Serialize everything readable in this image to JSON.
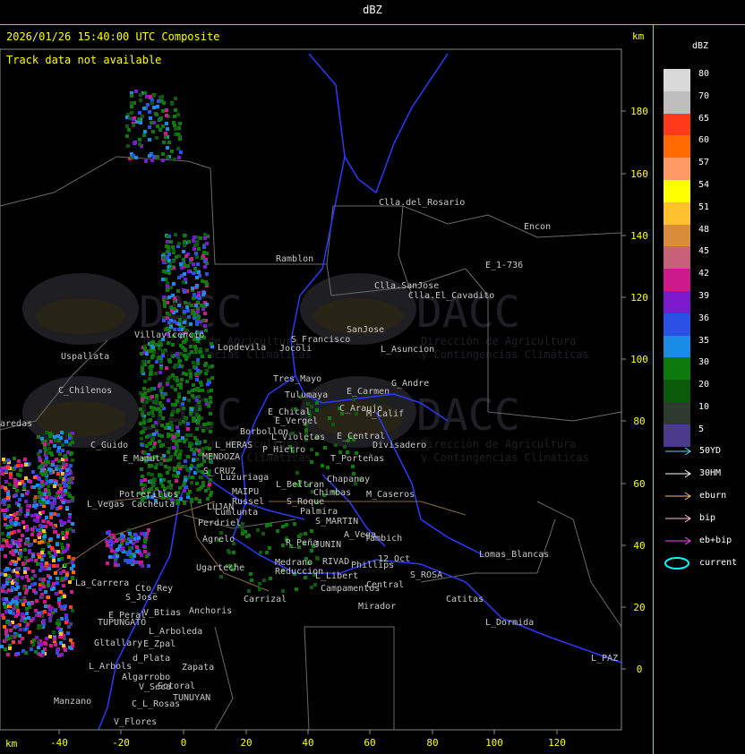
{
  "window": {
    "title": "dBZ"
  },
  "header": {
    "timestamp": "2026/01/26 15:40:00 UTC Composite",
    "track_status": "Track data not available",
    "km_label": "km"
  },
  "legend": {
    "title": "dBZ",
    "levels": [
      {
        "label": "80",
        "color": "#d9d9d9"
      },
      {
        "label": "70",
        "color": "#bdbdbd"
      },
      {
        "label": "65",
        "color": "#ff3a1a"
      },
      {
        "label": "60",
        "color": "#ff6a00"
      },
      {
        "label": "57",
        "color": "#ff9966"
      },
      {
        "label": "54",
        "color": "#ffff00"
      },
      {
        "label": "51",
        "color": "#ffc22e"
      },
      {
        "label": "48",
        "color": "#d98c3a"
      },
      {
        "label": "45",
        "color": "#c8607a"
      },
      {
        "label": "42",
        "color": "#cc1a8c"
      },
      {
        "label": "39",
        "color": "#7a1acc"
      },
      {
        "label": "36",
        "color": "#2a50e6"
      },
      {
        "label": "35",
        "color": "#1a8ce6"
      },
      {
        "label": "30",
        "color": "#0e7a0e"
      },
      {
        "label": "20",
        "color": "#0a5a0a"
      },
      {
        "label": "10",
        "color": "#2e3a2e"
      },
      {
        "label": "5",
        "color": "#4a3a8c"
      }
    ],
    "tracks": [
      {
        "label": "50YD",
        "color": "#6cf"
      },
      {
        "label": "30HM",
        "color": "#fff"
      },
      {
        "label": "eburn",
        "color": "#f0c080"
      },
      {
        "label": "bip",
        "color": "#ffc0d0"
      },
      {
        "label": "eb+bip",
        "color": "#ff40ff"
      },
      {
        "label": "current",
        "color": "#00ffff"
      }
    ]
  },
  "axes": {
    "x_ticks": [
      "-40",
      "-20",
      "0",
      "20",
      "40",
      "60",
      "80",
      "100",
      "120"
    ],
    "y_ticks": [
      "180",
      "160",
      "140",
      "120",
      "100",
      "80",
      "60",
      "40",
      "20",
      "0"
    ]
  },
  "watermark": {
    "brand": "DACC",
    "line1": "Dirección de Agricultura",
    "line2": "y Contingencias Climáticas"
  },
  "places": [
    "Clla.del_Rosario",
    "Encon",
    "Ramblon",
    "Clla.SanJose",
    "Clla.El_Cavadito",
    "E_1-736",
    "Villavicencio",
    "Uspallata",
    "Lopdevila",
    "Jocoli",
    "S_Francisco",
    "SanJose",
    "L_Asuncion",
    "C_Chilenos",
    "Tres_Mayo",
    "Tulumaya",
    "E_Carmen",
    "G_Andre",
    "E_Chical",
    "E_Vergel",
    "C_Araujo",
    "M_Calif",
    "Borbollon",
    "L_Violetas",
    "E_Central",
    "Divisadero",
    "C_Guido",
    "L_HERAS",
    "P_Hierro",
    "T_Porteñas",
    "E_Mamut",
    "MENDOZA",
    "S_CRUZ",
    "Luzuriaga",
    "L_Beltran",
    "Chapanay",
    "Potrerillos",
    "Cacheuta",
    "MAIPU",
    "Russel",
    "Chimbas",
    "M_Caseros",
    "L_Vegas",
    "LUJAN",
    "Cumlunta",
    "S_Roque",
    "Palmira",
    "Perdriel",
    "S_MARTIN",
    "A_Vega",
    "Tambich",
    "Agrelo",
    "R_Peña",
    "JUNIN",
    "12_Oct",
    "Lomas_Blancas",
    "Ugarteche",
    "Medrano",
    "RIVAD",
    "Phillips",
    "Reduccion",
    "L_Libert",
    "S_ROSA",
    "La_Carrera",
    "Cto_Rey",
    "Campamentos",
    "Central",
    "S_Jose",
    "Carrizal",
    "Catitas",
    "V_Btias",
    "Anchoris",
    "Mirador",
    "E_Peral",
    "TUPUNGATO",
    "L_Arboleda",
    "L_Dormida",
    "Gltallary",
    "E_Zpal",
    "d_Plata",
    "L_Arbols",
    "Zapata",
    "L_PAZ",
    "Algarrobo",
    "Sotoral",
    "V_Seca",
    "TUNUYAN",
    "Manzano",
    "C_L_Rosas",
    "V_Flores",
    "aredas"
  ]
}
